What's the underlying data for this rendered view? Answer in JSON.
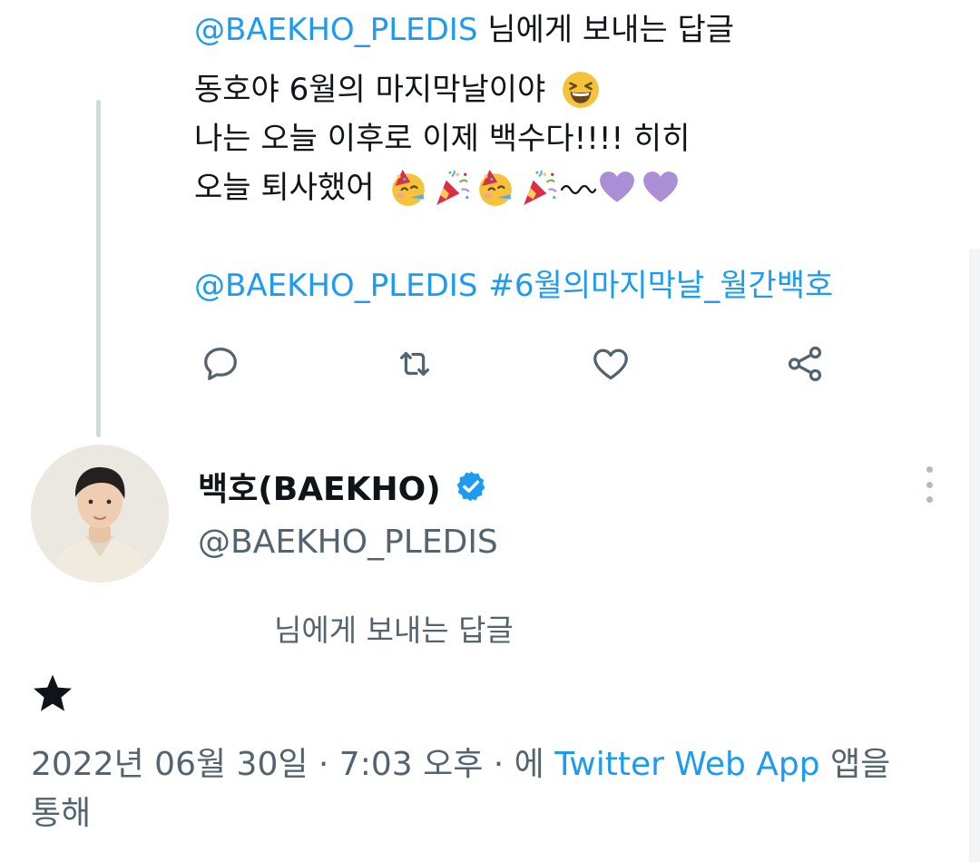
{
  "parent_tweet": {
    "reply_to_handle": "@BAEKHO_PLEDIS",
    "reply_to_suffix": "님에게 보내는 답글",
    "lines": {
      "line1_text": "동호야 6월의 마지막날이야",
      "line1_emoji": "grinning-squinting-face",
      "line2_text": "나는 오늘 이후로 이제 백수다!!!! 히히",
      "line3_text": "오늘 퇴사했어",
      "line3_tail": "〰",
      "line3_emojis": [
        "partying-face",
        "party-popper",
        "partying-face",
        "party-popper",
        "wavy-dash",
        "purple-heart",
        "purple-heart"
      ]
    },
    "mention_handle": "@BAEKHO_PLEDIS",
    "hashtag": "#6월의마지막날_월간백호"
  },
  "actions": {
    "reply_icon": "speech-bubble-icon",
    "retweet_icon": "retweet-icon",
    "like_icon": "heart-icon",
    "share_icon": "share-icon"
  },
  "reply_tweet": {
    "display_name": "백호(BAEKHO)",
    "handle": "@BAEKHO_PLEDIS",
    "reply_indicator": "님에게 보내는 답글",
    "body_icon": "star-icon",
    "timestamp": "2022년 06월 30일 · 7:03 오후 · 에",
    "source_app": "Twitter Web App",
    "source_suffix": "앱을",
    "source_suffix2": "통해"
  },
  "colors": {
    "accent": "#1d9bf0",
    "secondary_text": "#536471",
    "text": "#0f1419",
    "purple_heart": "#aa8ed6",
    "verified_badge": "#1d9bf0"
  }
}
